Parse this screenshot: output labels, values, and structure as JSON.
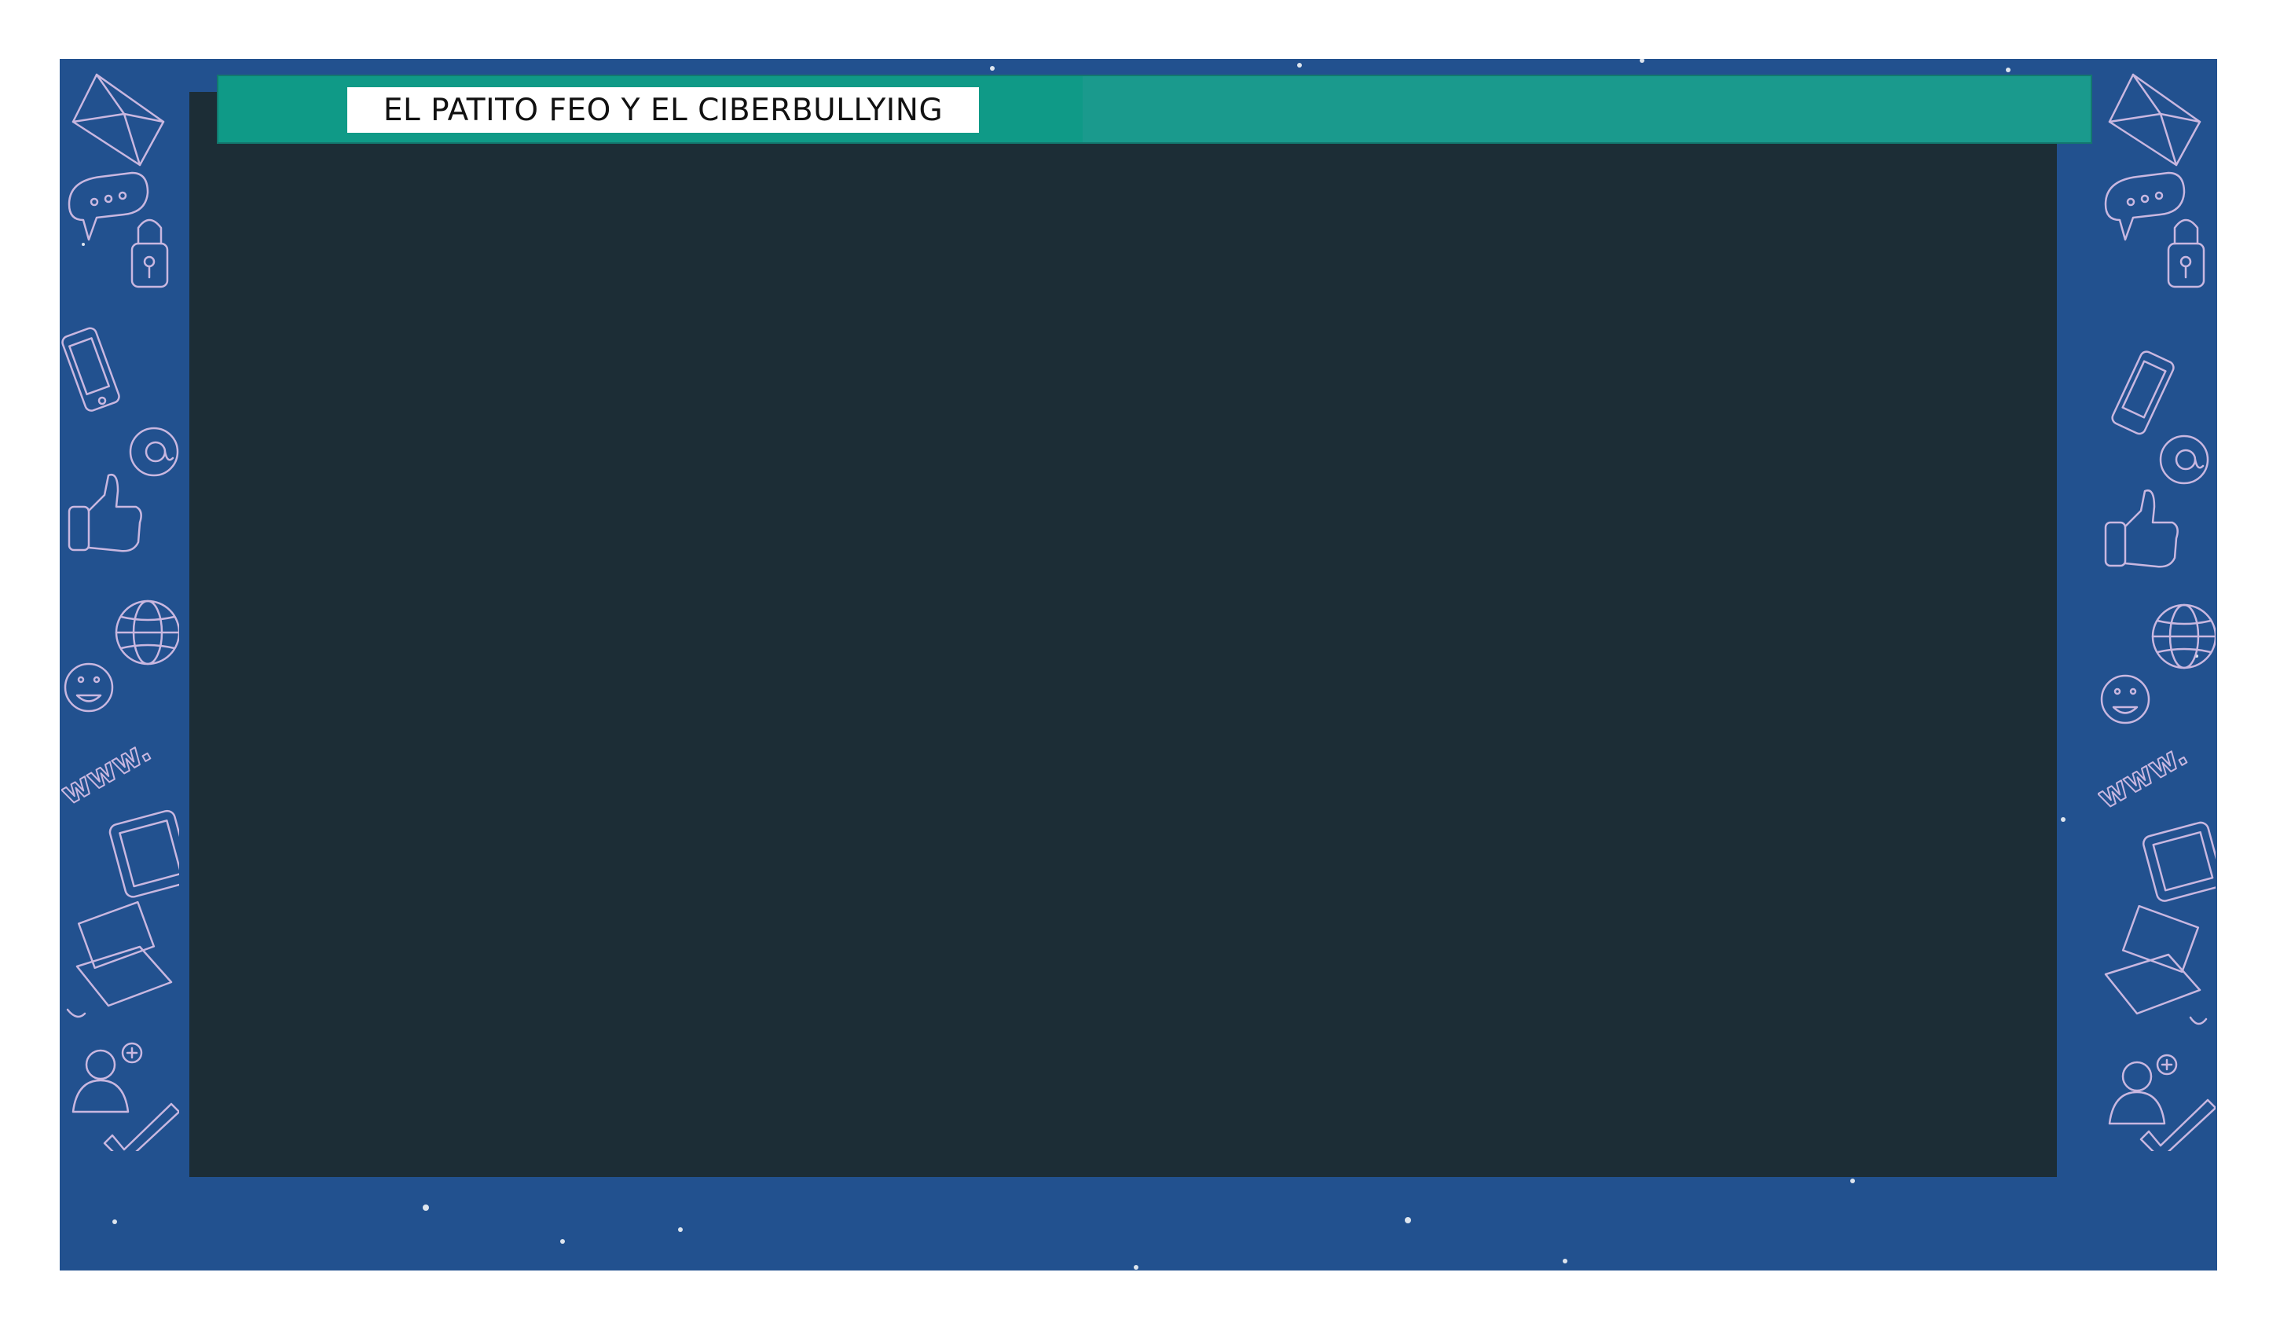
{
  "title": "EL PATITO FEO Y EL CIBERBULLYING",
  "colors": {
    "frame": "#22518f",
    "board": "#1c2d36",
    "titlebar": "#1a9a8d",
    "titlebar_accent": "#0f9a87",
    "title_box": "#ffffff"
  },
  "decor": {
    "left_icons": [
      "envelope-icon",
      "chat-bubble-icon",
      "padlock-icon",
      "smartphone-icon",
      "at-sign-icon",
      "thumbs-up-icon",
      "globe-icon",
      "smiley-icon",
      "www-text-icon",
      "tablet-icon",
      "laptop-icon",
      "user-add-icon",
      "checkmark-icon"
    ],
    "right_icons": [
      "envelope-icon",
      "chat-bubble-icon",
      "padlock-icon",
      "smartphone-icon",
      "at-sign-icon",
      "thumbs-up-icon",
      "globe-icon",
      "smiley-icon",
      "www-text-icon",
      "tablet-icon",
      "laptop-icon",
      "user-add-icon",
      "checkmark-icon"
    ],
    "www_label": "www."
  }
}
